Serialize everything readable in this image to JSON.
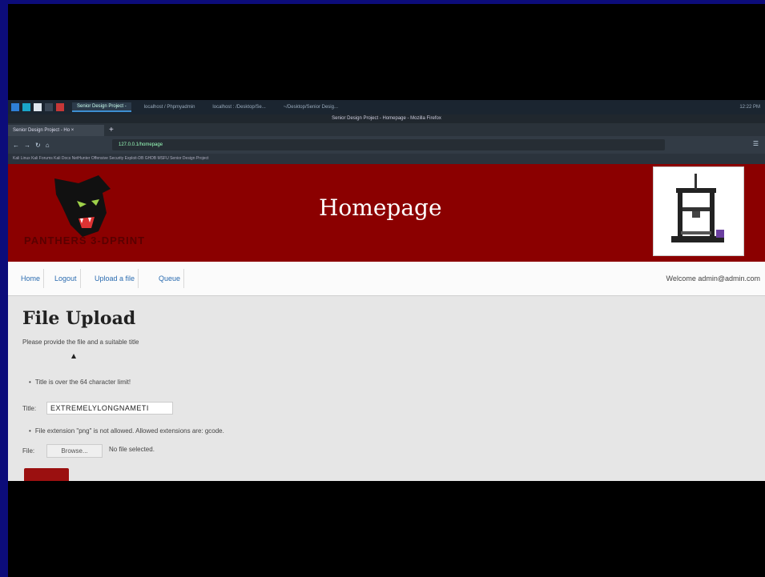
{
  "taskbar": {
    "tasks": [
      "Senior Design Project -",
      "localhost / Phpmyadmin",
      "localhost : /Desktop/Se...",
      "~/Desktop/Senior Desig..."
    ],
    "right": "12:22 PM"
  },
  "browser": {
    "window_title": "Senior Design Project - Homepage - Mozilla Firefox",
    "tab_label": "Senior Design Project - Ho ×",
    "url": "127.0.0.1/homepage",
    "bookmarks": "Kali Linux   Kali Forums   Kali Docs   NetHunter   Offensive Security   Exploit-DB   GHDB   MSFU   Senior Design Project"
  },
  "header": {
    "logo_text": "PANTHERS 3-DPRINT",
    "title": "Homepage"
  },
  "nav": {
    "links": [
      "Home",
      "Logout",
      "Upload a file",
      "Queue"
    ],
    "welcome": "Welcome admin@admin.com"
  },
  "content": {
    "heading": "File Upload",
    "subtitle": "Please provide the file and a suitable title",
    "title_error": "Title is over the 64 character limit!",
    "title_label": "Title:",
    "title_value": "EXTREMELYLONGNAMETI",
    "file_error": "File extension \"png\" is not allowed. Allowed extensions are: gcode.",
    "file_label": "File:",
    "browse_label": "Browse...",
    "no_file": "No file selected."
  },
  "colors": {
    "header_bg": "#8b0000",
    "accent_link": "#2b6cb0",
    "submit_bg": "#9b1010"
  }
}
